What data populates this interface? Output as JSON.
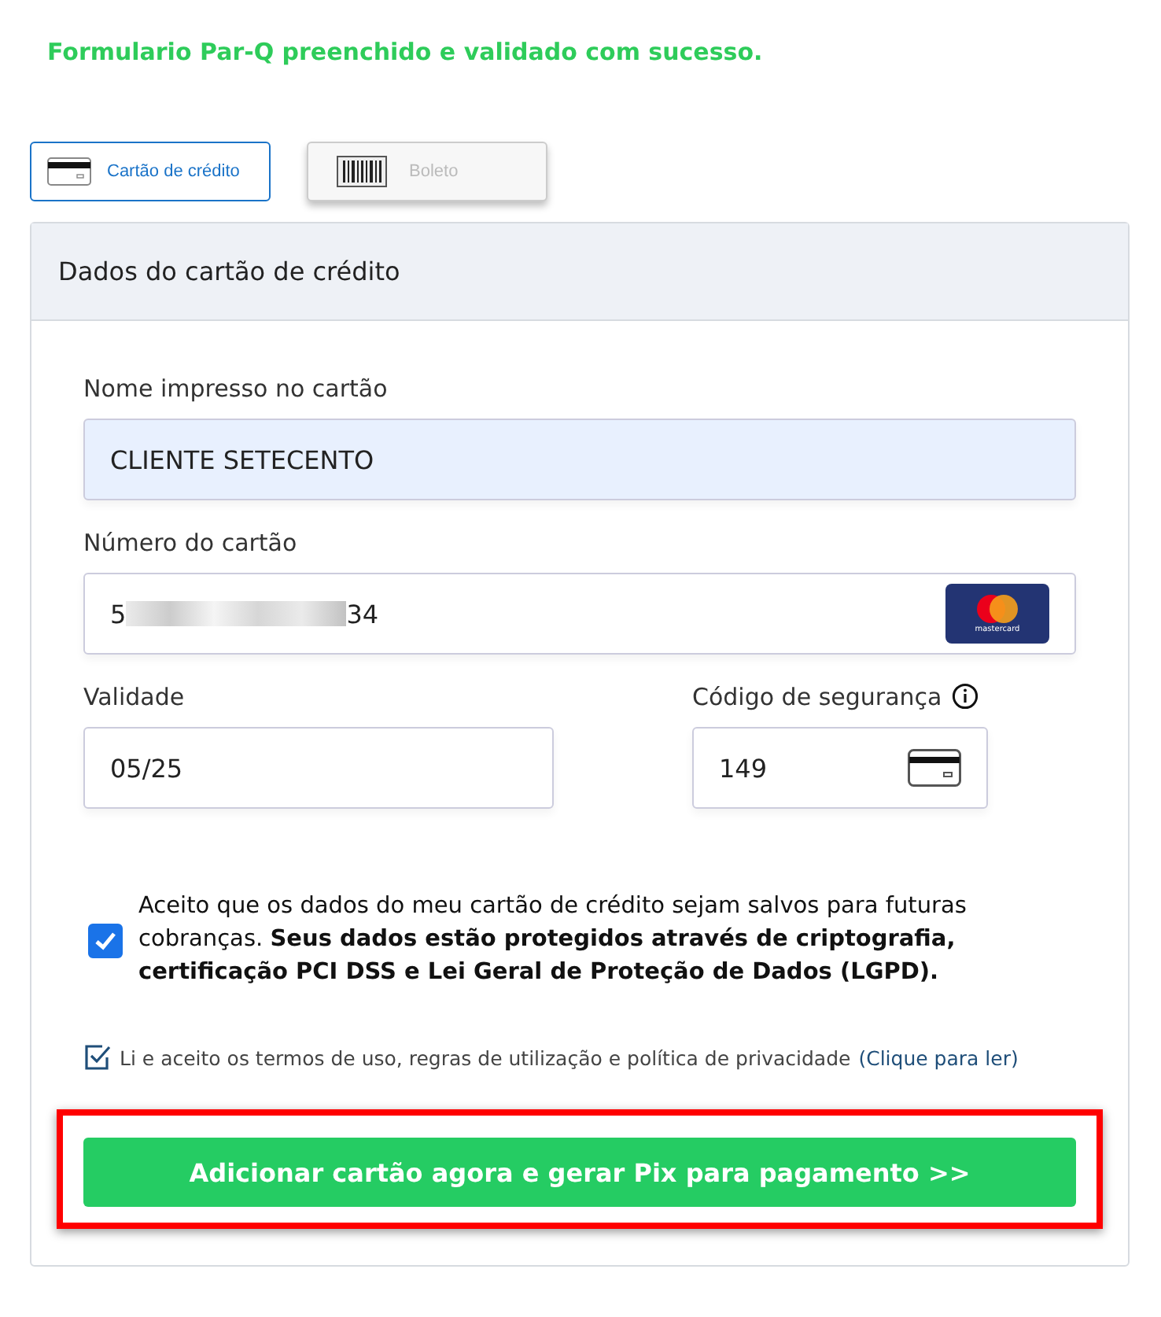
{
  "success_message": "Formulario Par-Q preenchido e validado com sucesso.",
  "tabs": [
    {
      "label": "Cartão de crédito",
      "kind": "card",
      "selected": true
    },
    {
      "label": "Boleto",
      "kind": "barcode",
      "selected": false
    }
  ],
  "panel": {
    "title": "Dados do cartão de crédito",
    "name_field": {
      "label": "Nome impresso no cartão",
      "value": "CLIENTE SETECENTO"
    },
    "number_field": {
      "label": "Número do cartão",
      "value_start": "5",
      "value_end": "34",
      "brand_text": "mastercard"
    },
    "expiry_field": {
      "label": "Validade",
      "value": "05/25"
    },
    "cvv_field": {
      "label": "Código de segurança",
      "value": "149"
    },
    "save_consent": {
      "checked": true,
      "text": "Aceito que os dados do meu cartão de crédito sejam salvos para futuras cobranças. **Seus dados estão protegidos através de criptografia, certificação PCI DSS e Lei Geral de Proteção de Dados (LGPD).**"
    },
    "terms": {
      "checked": true,
      "text": "Li e aceito os termos de uso, regras de utilização e política de privacidade",
      "link": "(Clique para ler)"
    },
    "submit": {
      "label": "Adicionar cartão agora e gerar Pix para pagamento >>",
      "highlighted": true
    }
  }
}
